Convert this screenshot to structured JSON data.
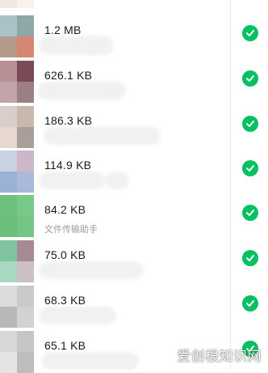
{
  "files": [
    {
      "size": "",
      "source": "",
      "checked": true,
      "thumb": [
        "#d35a3a",
        "#e85d2e",
        "#f3e7e3",
        "#f7f2f0"
      ]
    },
    {
      "size": "1.2 MB",
      "source": "",
      "checked": true,
      "thumb": [
        "#a9c2c6",
        "#8fa7a8",
        "#b59a8c",
        "#d48872"
      ]
    },
    {
      "size": "626.1 KB",
      "source": "",
      "checked": true,
      "thumb": [
        "#b88f92",
        "#7a4a55",
        "#c1a4aa",
        "#9c7f86"
      ]
    },
    {
      "size": "186.3 KB",
      "source": "",
      "checked": true,
      "thumb": [
        "#d9cfc8",
        "#c9b8ad",
        "#e7d8cf",
        "#aa9f98"
      ]
    },
    {
      "size": "114.9 KB",
      "source": "",
      "checked": true,
      "thumb": [
        "#c9d3e2",
        "#cdb6c7",
        "#9bb2d4",
        "#a8b9da"
      ]
    },
    {
      "size": "84.2 KB",
      "source": "文件传输助手",
      "checked": true,
      "thumb": [
        "#6dc07c",
        "#78c88a",
        "#6cbf7a",
        "#74c584"
      ]
    },
    {
      "size": "75.0 KB",
      "source": "",
      "checked": true,
      "thumb": [
        "#7fc3a0",
        "#a58a94",
        "#a9d9c2",
        "#cbc1c4"
      ]
    },
    {
      "size": "68.3 KB",
      "source": "",
      "checked": true,
      "thumb": [
        "#dcdcdc",
        "#c9c9c9",
        "#b8b8b8",
        "#d2d2d2"
      ]
    },
    {
      "size": "65.1 KB",
      "source": "",
      "checked": true,
      "thumb": [
        "#d8d8d8",
        "#c5c5c5",
        "#e4e4e4",
        "#bdbdbd"
      ]
    }
  ],
  "watermark": "爱创根知识网",
  "colors": {
    "check": "#07c160",
    "size_text": "#1a1a1a",
    "source_text": "#9a9a9a"
  },
  "icons": {
    "check": "checkmark-circle-icon"
  }
}
